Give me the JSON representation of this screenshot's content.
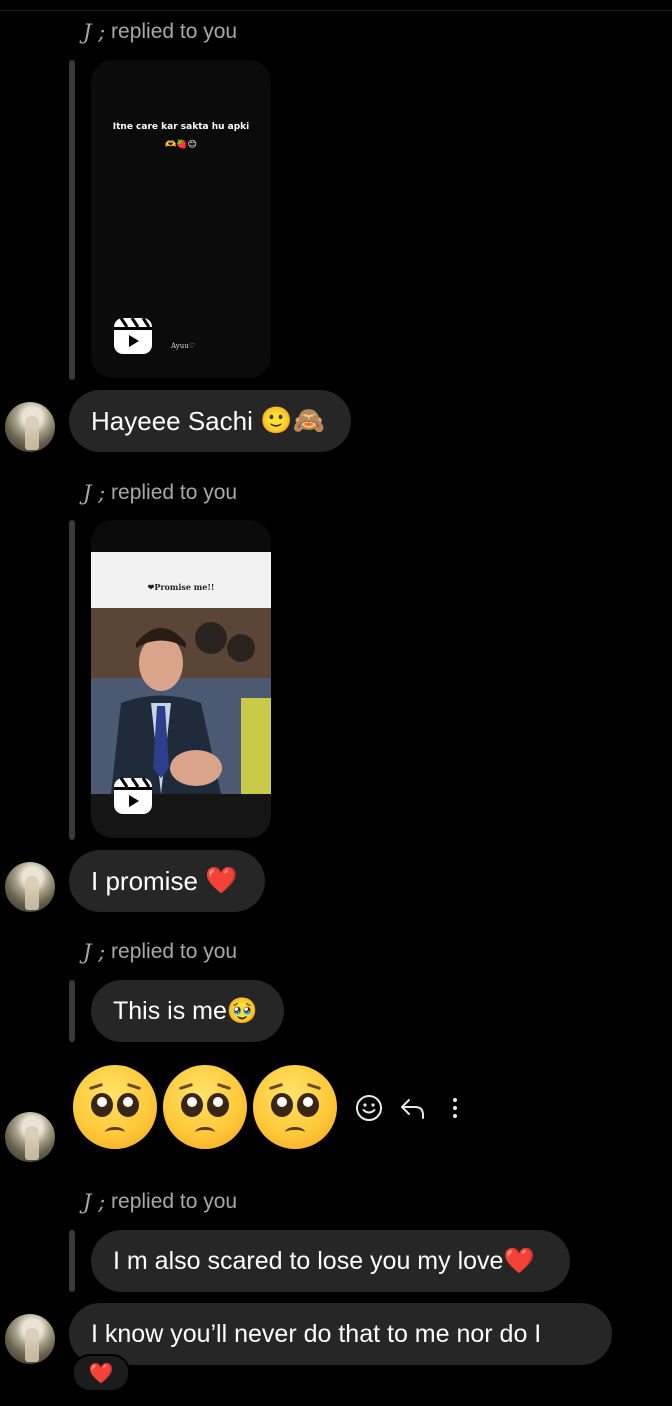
{
  "thread": {
    "reply_label_1": "replied to you",
    "reply_label_2": "replied to you",
    "reply_label_3": "replied to you",
    "reply_label_4": "replied to you",
    "reply_prefix": "J ;",
    "reel_1": {
      "caption": "Itne care kar sakta hu apki",
      "author": "Ayuu♡"
    },
    "reel_2": {
      "caption": "❤Promise me!!"
    },
    "msg_1": "Hayeee Sachi",
    "msg_1_emoji": "🙂🙈",
    "msg_2": "I promise",
    "msg_2_emoji": "❤️",
    "quoted_3": "This is me🥹",
    "quoted_4": "I m also scared to lose you my love❤️",
    "msg_4": "I know you’ll never do that to me nor do I",
    "reaction_4": "❤️",
    "big_emoji_count": 3,
    "icons": {
      "react": "smiley-icon",
      "reply": "reply-arrow-icon",
      "more": "more-vertical-icon",
      "reel": "reels-icon"
    }
  }
}
